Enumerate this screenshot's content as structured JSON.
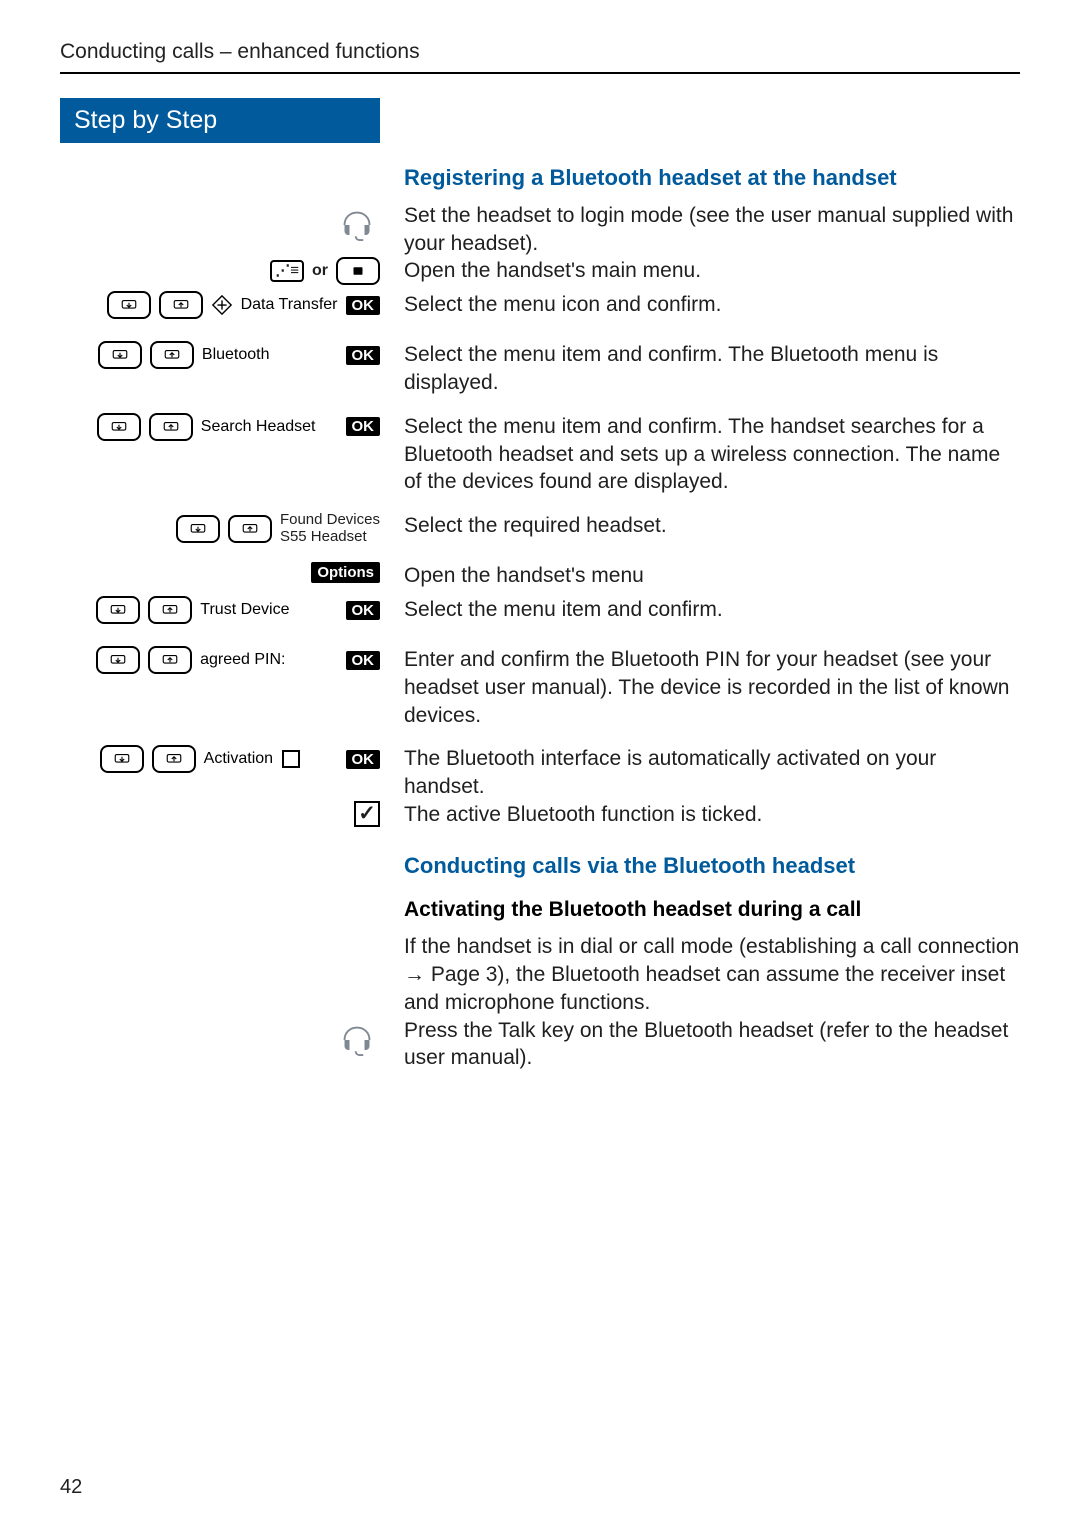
{
  "header": "Conducting calls – enhanced functions",
  "step_banner": "Step by Step",
  "page_number": "42",
  "h_registering": "Registering a Bluetooth headset at the handset",
  "h_conducting": "Conducting calls via the Bluetooth headset",
  "h_activating": "Activating the Bluetooth headset during a call",
  "text": {
    "set_headset": "Set the headset to login mode (see the user manual supplied with your headset).",
    "open_menu": "Open the handset's main menu.",
    "select_icon": "Select the menu icon and confirm.",
    "bluetooth_desc": "Select the menu item and confirm. The Bluetooth menu is displayed.",
    "search_desc": "Select the menu item and confirm. The handset searches for a Bluetooth headset and sets up a wireless connection. The name of the devices found are displayed.",
    "select_headset": "Select the required headset.",
    "open_hs_menu": "Open the handset's menu",
    "trust_desc": "Select the menu item and confirm.",
    "pin_desc": "Enter and confirm the Bluetooth PIN for your headset (see your headset user manual). The device is recorded in the list of known devices.",
    "activation_desc": "The Bluetooth interface is automatically activated on your handset.",
    "ticked": "The active Bluetooth function is ticked.",
    "dial_mode": "If the handset is in dial or call mode (establishing a call connection → Page 3), the Bluetooth headset can assume the receiver inset and microphone functions.",
    "press_talk": "Press the Talk key on the Bluetooth headset (refer to the headset user manual)."
  },
  "left": {
    "or": "or",
    "data_transfer": "Data Transfer",
    "bluetooth": "Bluetooth",
    "search": "Search Headset",
    "found1": "Found Devices",
    "found2": "S55 Headset",
    "options": "Options",
    "trust": "Trust Device",
    "pin": "agreed PIN:",
    "activation": "Activation",
    "ok": "OK"
  }
}
